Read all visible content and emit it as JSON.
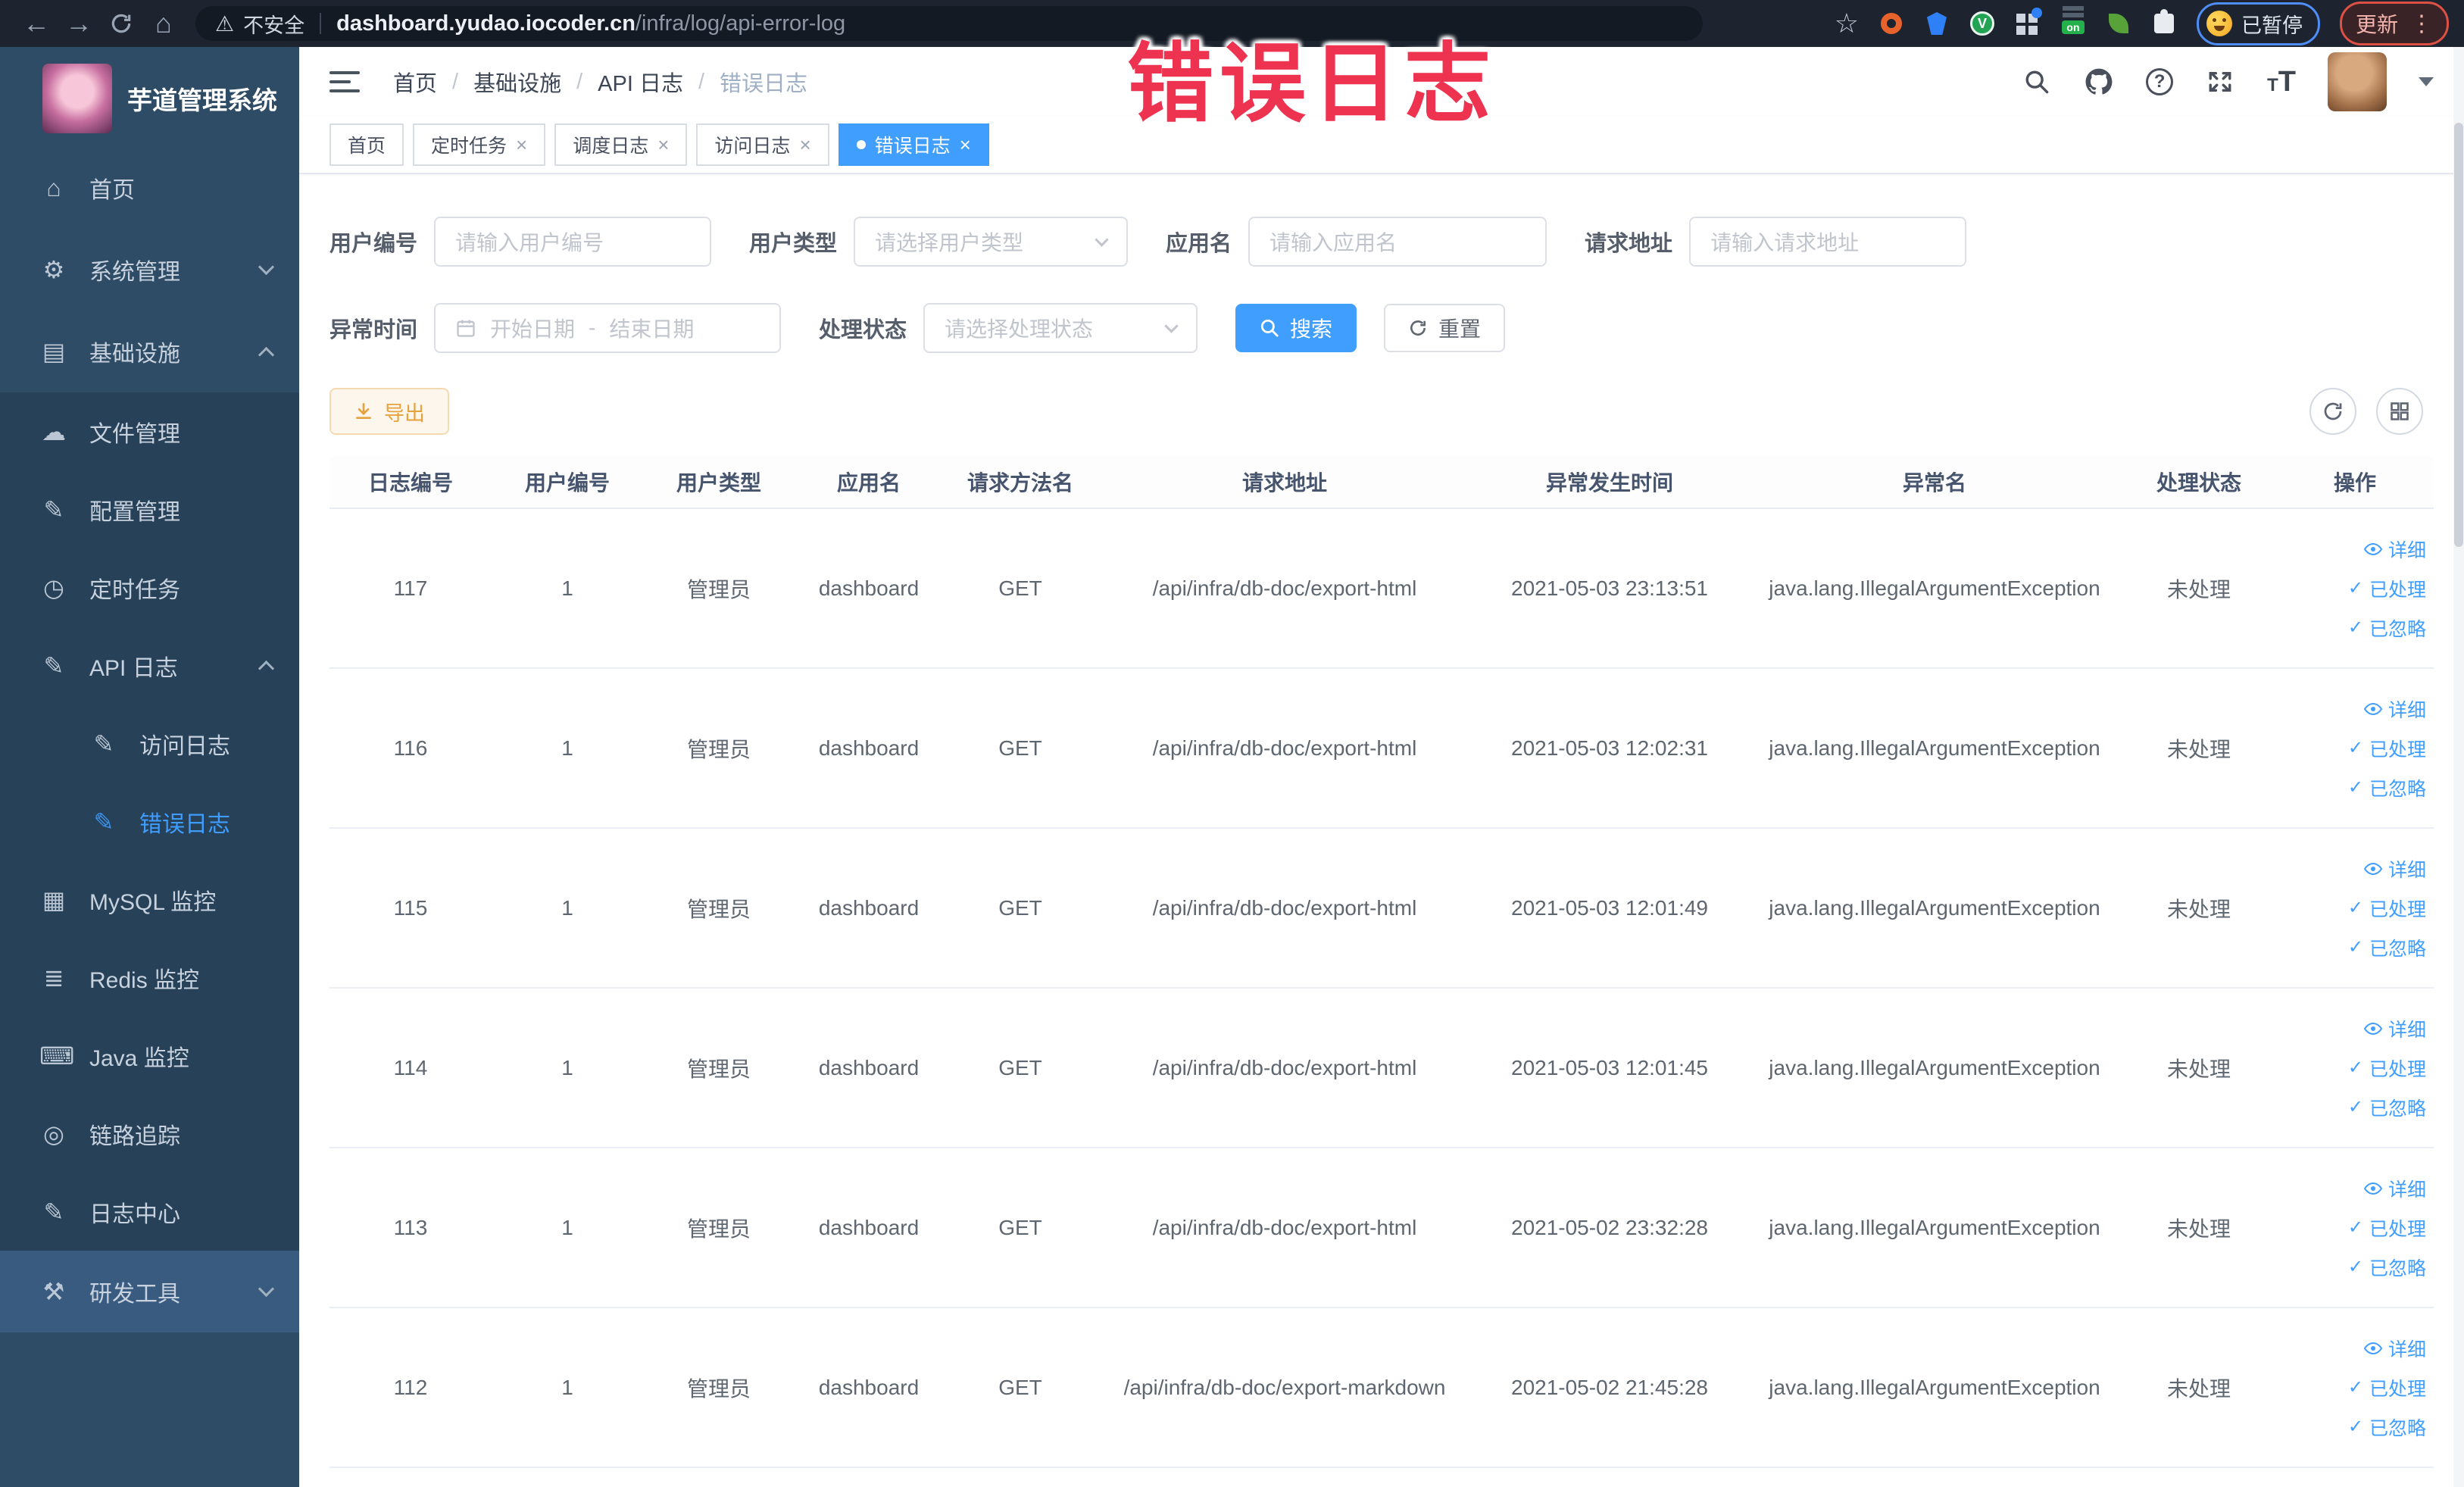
{
  "browser": {
    "security_label": "不安全",
    "url_host": "dashboard.yudao.iocoder.cn",
    "url_path": "/infra/log/api-error-log",
    "paused_badge": "已暂停",
    "update_button": "更新"
  },
  "annotation": {
    "text": "错误日志",
    "color": "#ee3350"
  },
  "sidebar": {
    "title": "芋道管理系统",
    "items": [
      {
        "label": "首页"
      },
      {
        "label": "系统管理"
      },
      {
        "label": "基础设施"
      },
      {
        "label": "文件管理"
      },
      {
        "label": "配置管理"
      },
      {
        "label": "定时任务"
      },
      {
        "label": "API 日志"
      },
      {
        "label": "访问日志"
      },
      {
        "label": "错误日志"
      },
      {
        "label": "MySQL 监控"
      },
      {
        "label": "Redis 监控"
      },
      {
        "label": "Java 监控"
      },
      {
        "label": "链路追踪"
      },
      {
        "label": "日志中心"
      },
      {
        "label": "研发工具"
      }
    ]
  },
  "breadcrumb": {
    "items": [
      "首页",
      "基础设施",
      "API 日志",
      "错误日志"
    ]
  },
  "tabs": [
    {
      "label": "首页"
    },
    {
      "label": "定时任务"
    },
    {
      "label": "调度日志"
    },
    {
      "label": "访问日志"
    },
    {
      "label": "错误日志"
    }
  ],
  "filters": {
    "user_id": {
      "label": "用户编号",
      "placeholder": "请输入用户编号"
    },
    "user_type": {
      "label": "用户类型",
      "placeholder": "请选择用户类型"
    },
    "app_name": {
      "label": "应用名",
      "placeholder": "请输入应用名"
    },
    "request_url": {
      "label": "请求地址",
      "placeholder": "请输入请求地址"
    },
    "exception_time": {
      "label": "异常时间",
      "start_placeholder": "开始日期",
      "separator": "-",
      "end_placeholder": "结束日期"
    },
    "process_status": {
      "label": "处理状态",
      "placeholder": "请选择处理状态"
    },
    "search_label": "搜索",
    "reset_label": "重置"
  },
  "toolbar": {
    "export_label": "导出"
  },
  "table": {
    "columns": [
      "日志编号",
      "用户编号",
      "用户类型",
      "应用名",
      "请求方法名",
      "请求地址",
      "异常发生时间",
      "异常名",
      "处理状态",
      "操作"
    ],
    "actions": {
      "detail": "详细",
      "processed": "已处理",
      "ignored": "已忽略"
    },
    "rows": [
      {
        "id": "117",
        "user_id": "1",
        "user_type": "管理员",
        "app_name": "dashboard",
        "method": "GET",
        "url": "/api/infra/db-doc/export-html",
        "time": "2021-05-03 23:13:51",
        "exception": "java.lang.IllegalArgumentException",
        "status": "未处理"
      },
      {
        "id": "116",
        "user_id": "1",
        "user_type": "管理员",
        "app_name": "dashboard",
        "method": "GET",
        "url": "/api/infra/db-doc/export-html",
        "time": "2021-05-03 12:02:31",
        "exception": "java.lang.IllegalArgumentException",
        "status": "未处理"
      },
      {
        "id": "115",
        "user_id": "1",
        "user_type": "管理员",
        "app_name": "dashboard",
        "method": "GET",
        "url": "/api/infra/db-doc/export-html",
        "time": "2021-05-03 12:01:49",
        "exception": "java.lang.IllegalArgumentException",
        "status": "未处理"
      },
      {
        "id": "114",
        "user_id": "1",
        "user_type": "管理员",
        "app_name": "dashboard",
        "method": "GET",
        "url": "/api/infra/db-doc/export-html",
        "time": "2021-05-03 12:01:45",
        "exception": "java.lang.IllegalArgumentException",
        "status": "未处理"
      },
      {
        "id": "113",
        "user_id": "1",
        "user_type": "管理员",
        "app_name": "dashboard",
        "method": "GET",
        "url": "/api/infra/db-doc/export-html",
        "time": "2021-05-02 23:32:28",
        "exception": "java.lang.IllegalArgumentException",
        "status": "未处理"
      },
      {
        "id": "112",
        "user_id": "1",
        "user_type": "管理员",
        "app_name": "dashboard",
        "method": "GET",
        "url": "/api/infra/db-doc/export-markdown",
        "time": "2021-05-02 21:45:28",
        "exception": "java.lang.IllegalArgumentException",
        "status": "未处理"
      }
    ]
  }
}
